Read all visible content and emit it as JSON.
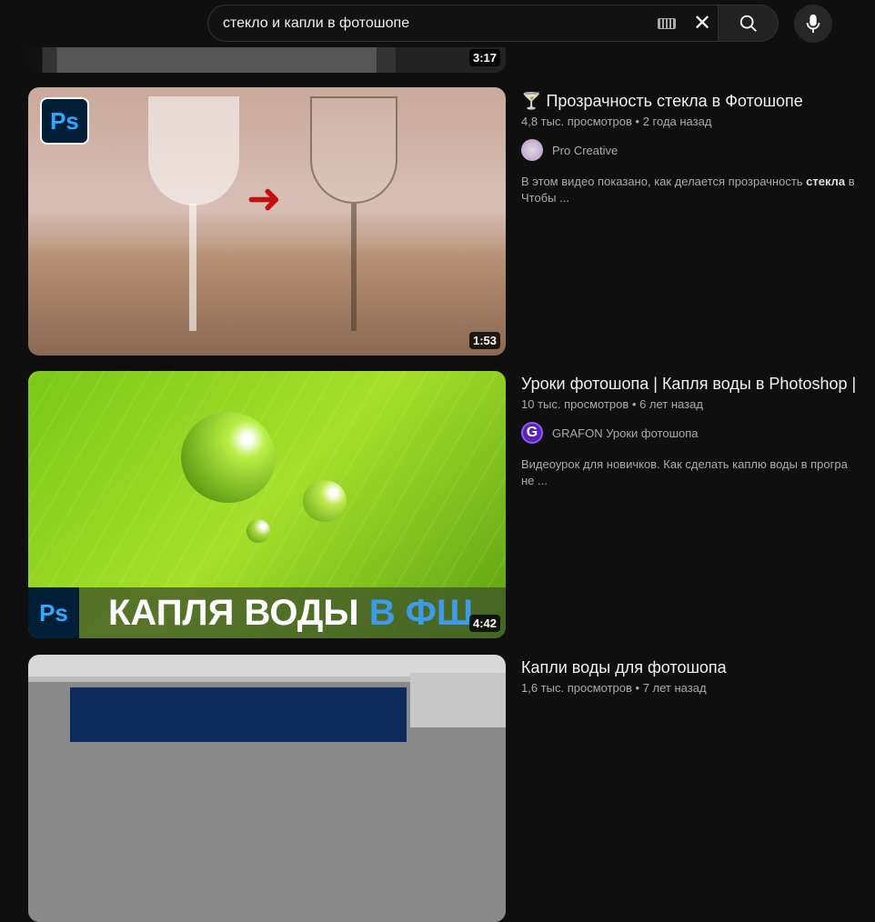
{
  "search": {
    "query": "стекло и капли в фотошопе",
    "icons": [
      "keyboard-icon",
      "clear-icon",
      "search-icon",
      "microphone-icon"
    ]
  },
  "videos": [
    {
      "duration": "3:17"
    },
    {
      "title_emoji": "🍸",
      "title": "Прозрачность стекла в Фотошопе",
      "views": "4,8 тыс. просмотров",
      "age": "2 года назад",
      "channel": "Pro Creative",
      "desc_before": "В этом видео показано, как делается прозрачность ",
      "desc_bold": "стекла",
      "desc_after": " в",
      "desc_line2": "Чтобы ...",
      "duration": "1:53",
      "badge": "Ps"
    },
    {
      "title": "Уроки фотошопа | Капля воды в Photoshop |",
      "views": "10 тыс. просмотров",
      "age": "6 лет назад",
      "channel": "GRAFON Уроки фотошопа",
      "desc": "Видеоурок для новичков. Как сделать каплю воды в програ",
      "desc_line2": "не ...",
      "duration": "4:42",
      "badge": "Ps",
      "overlay_a": "КАПЛЯ ВОДЫ ",
      "overlay_b": "В ФШ",
      "accent": "#3d9be9"
    },
    {
      "title": "Капли воды для фотошопа",
      "views": "1,6 тыс. просмотров",
      "age": "7 лет назад"
    }
  ]
}
